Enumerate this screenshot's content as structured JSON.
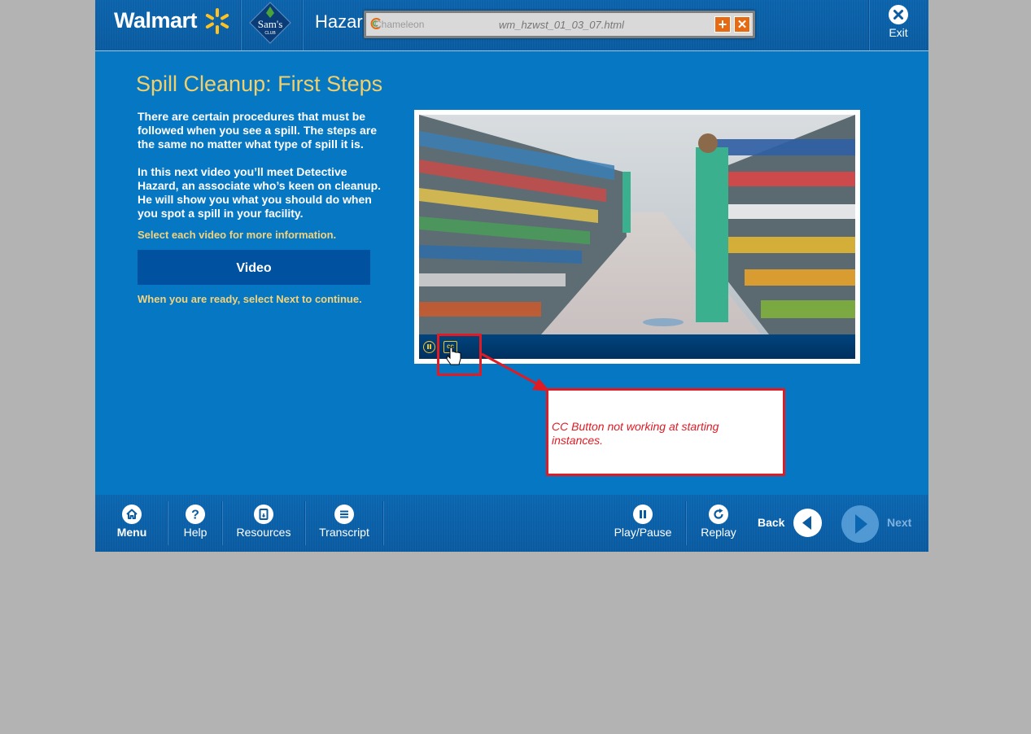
{
  "header": {
    "logo_text": "Walmart",
    "sams_logo_text": "Sam's",
    "sams_logo_sub": "CLUB",
    "course_title": "Hazar",
    "exit_label": "Exit"
  },
  "toolbar": {
    "brand": "Chameleon",
    "filename": "wm_hzwst_01_03_07.html",
    "add_symbol": "+",
    "close_symbol": "✕"
  },
  "content": {
    "title": "Spill Cleanup:  First Steps",
    "paragraph1": "There are certain procedures that must be followed when you see a spill.  The steps are the same no matter what type of spill it is.",
    "paragraph2": "In this next video you’ll meet Detective Hazard, an associate who’s keen on cleanup. He will show you what you should do when you spot a spill in your facility.",
    "select_hint": "Select each video for more information.",
    "video_button_label": "Video",
    "continue_hint": "When you are ready, select Next to continue."
  },
  "player": {
    "cc_label": "cc"
  },
  "footer": {
    "menu": "Menu",
    "help": "Help",
    "resources": "Resources",
    "transcript": "Transcript",
    "play_pause": "Play/Pause",
    "replay": "Replay",
    "back": "Back",
    "next": "Next"
  },
  "annotation": {
    "text": "CC Button not working at starting instances."
  },
  "colors": {
    "app_blue": "#0677c3",
    "title_gold": "#f1cf6b",
    "annotation_red": "#e01b24",
    "spark_yellow": "#ffc220"
  },
  "icons": [
    "close-icon",
    "home-icon",
    "help-icon",
    "resources-icon",
    "transcript-icon",
    "pause-icon",
    "replay-icon",
    "back-arrow-icon",
    "next-arrow-icon",
    "cc-icon",
    "pause-control-icon",
    "hand-cursor-icon"
  ]
}
